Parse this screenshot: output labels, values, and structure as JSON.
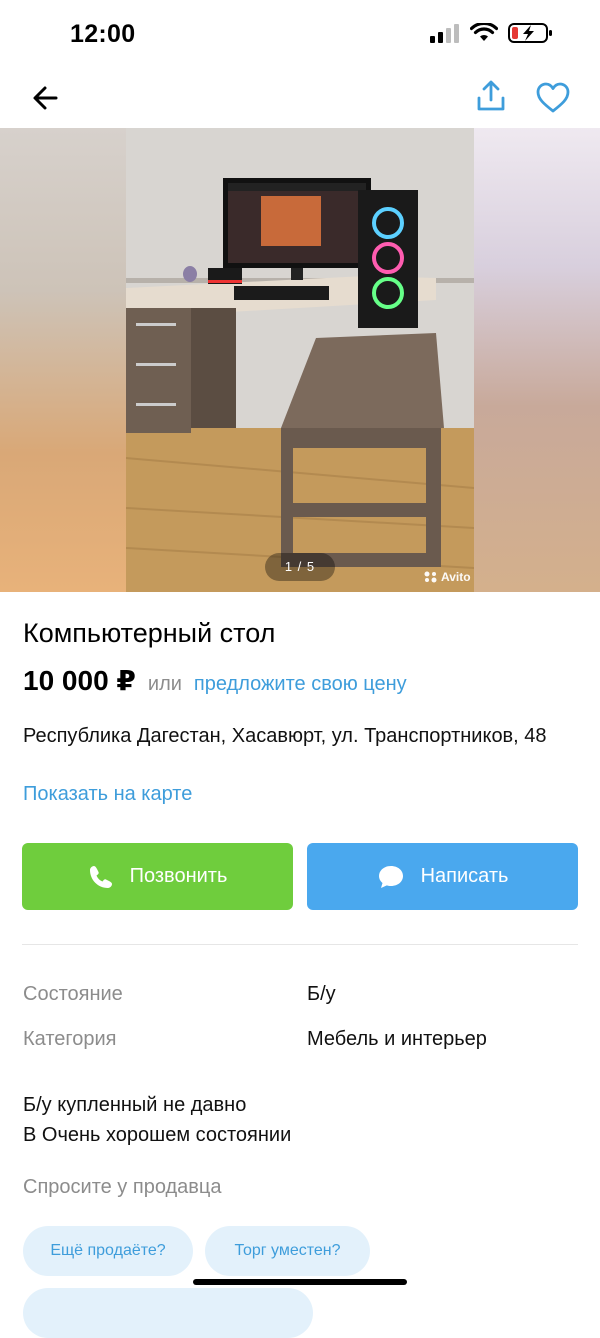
{
  "status_bar": {
    "time": "12:00"
  },
  "gallery": {
    "counter": "1 / 5",
    "watermark": "Avito"
  },
  "listing": {
    "title": "Компьютерный стол",
    "price": "10 000 ₽",
    "or_text": "или",
    "offer_link": "предложите свою цену",
    "address": "Республика Дагестан, Хасавюрт, ул. Транспортников, 48",
    "map_link": "Показать на карте"
  },
  "actions": {
    "call_label": "Позвонить",
    "write_label": "Написать"
  },
  "params": [
    {
      "label": "Состояние",
      "value": "Б/у"
    },
    {
      "label": "Категория",
      "value": "Мебель и интерьер"
    }
  ],
  "description": [
    "Б/у купленный не давно",
    "В Очень хорошем состоянии"
  ],
  "ask_seller": {
    "title": "Спросите у продавца",
    "chips": [
      "Ещё продаёте?",
      "Торг уместен?",
      ""
    ]
  },
  "colors": {
    "accent": "#3e9ddb",
    "call": "#6fcd3d",
    "write": "#4aa8ee"
  }
}
